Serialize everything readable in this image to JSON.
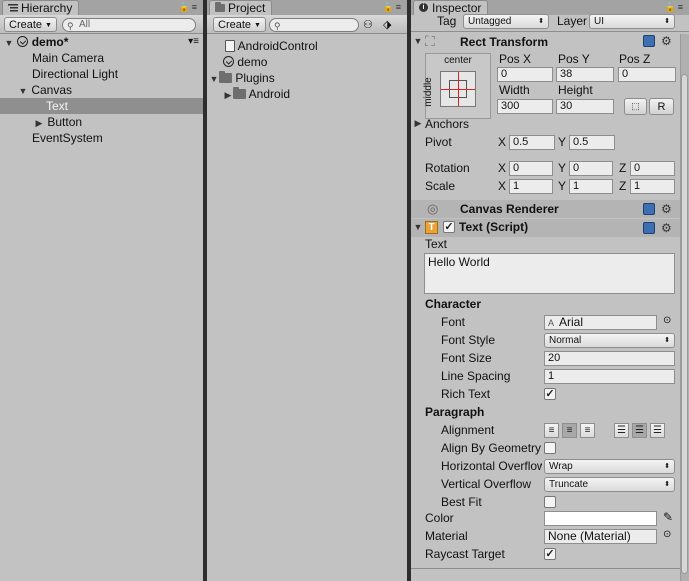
{
  "hierarchy": {
    "tab_title": "Hierarchy",
    "create_label": "Create",
    "search_placeholder": "All",
    "scene_name": "demo*",
    "items": [
      {
        "label": "Main Camera"
      },
      {
        "label": "Directional Light"
      },
      {
        "label": "Canvas"
      },
      {
        "label": "Text"
      },
      {
        "label": "Button"
      },
      {
        "label": "EventSystem"
      }
    ]
  },
  "project": {
    "tab_title": "Project",
    "create_label": "Create",
    "search_placeholder": "",
    "items": [
      {
        "label": "AndroidControl"
      },
      {
        "label": "demo"
      },
      {
        "label": "Plugins"
      },
      {
        "label": "Android"
      }
    ]
  },
  "inspector": {
    "tab_title": "Inspector",
    "tag_label": "Tag",
    "tag_value": "Untagged",
    "layer_label": "Layer",
    "layer_value": "UI",
    "rect_transform": {
      "title": "Rect Transform",
      "anchor_h": "center",
      "anchor_v": "middle",
      "pos_x_label": "Pos X",
      "pos_x": "0",
      "pos_y_label": "Pos Y",
      "pos_y": "38",
      "pos_z_label": "Pos Z",
      "pos_z": "0",
      "width_label": "Width",
      "width": "300",
      "height_label": "Height",
      "height": "30",
      "r_button": "R",
      "anchors_label": "Anchors",
      "pivot_label": "Pivot",
      "pivot_x": "0.5",
      "pivot_y": "0.5",
      "rotation_label": "Rotation",
      "rot_x": "0",
      "rot_y": "0",
      "rot_z": "0",
      "scale_label": "Scale",
      "scale_x": "1",
      "scale_y": "1",
      "scale_z": "1",
      "x": "X",
      "y": "Y",
      "z": "Z"
    },
    "canvas_renderer": {
      "title": "Canvas Renderer"
    },
    "text_script": {
      "title": "Text (Script)",
      "text_label": "Text",
      "text_value": "Hello World",
      "character_label": "Character",
      "font_label": "Font",
      "font_value": "Arial",
      "font_style_label": "Font Style",
      "font_style_value": "Normal",
      "font_size_label": "Font Size",
      "font_size_value": "20",
      "line_spacing_label": "Line Spacing",
      "line_spacing_value": "1",
      "rich_text_label": "Rich Text",
      "paragraph_label": "Paragraph",
      "alignment_label": "Alignment",
      "align_by_geometry_label": "Align By Geometry",
      "horizontal_overflow_label": "Horizontal Overflow",
      "horizontal_overflow_value": "Wrap",
      "vertical_overflow_label": "Vertical Overflow",
      "vertical_overflow_value": "Truncate",
      "best_fit_label": "Best Fit",
      "color_label": "Color",
      "material_label": "Material",
      "material_value": "None (Material)",
      "raycast_target_label": "Raycast Target"
    }
  }
}
